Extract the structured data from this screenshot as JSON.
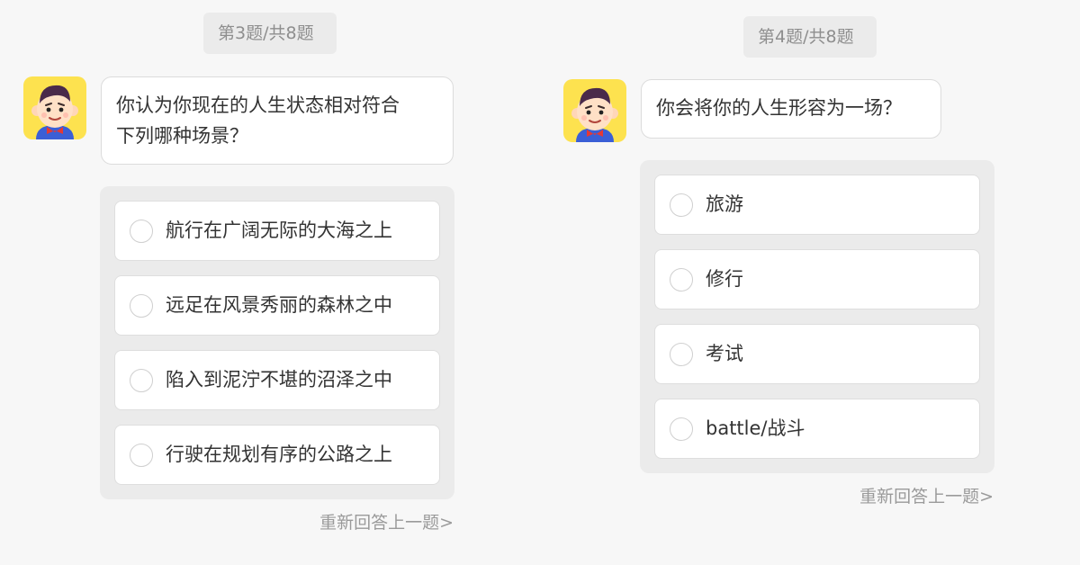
{
  "colors": {
    "background": "#f7f7f7",
    "panel_gray": "#ebebeb",
    "avatar_bg": "#fde24f",
    "text_muted": "#8e8e8e"
  },
  "left": {
    "progress": "第3题/共8题",
    "avatar_icon": "cartoon-boy-avatar-icon",
    "question_line1": "你认为你现在的人生状态相对符合",
    "question_line2": "下列哪种场景？",
    "options": [
      {
        "label": "航行在广阔无际的大海之上",
        "selected": false
      },
      {
        "label": "远足在风景秀丽的森林之中",
        "selected": false
      },
      {
        "label": "陷入到泥泞不堪的沼泽之中",
        "selected": false
      },
      {
        "label": "行驶在规划有序的公路之上",
        "selected": false
      }
    ],
    "redo": "重新回答上一题>"
  },
  "right": {
    "progress": "第4题/共8题",
    "avatar_icon": "cartoon-boy-avatar-icon",
    "question_line1": "你会将你的人生形容为一场？",
    "options": [
      {
        "label": "旅游",
        "selected": false
      },
      {
        "label": "修行",
        "selected": false
      },
      {
        "label": "考试",
        "selected": false
      },
      {
        "label": "battle/战斗",
        "selected": false
      }
    ],
    "redo": "重新回答上一题>"
  }
}
